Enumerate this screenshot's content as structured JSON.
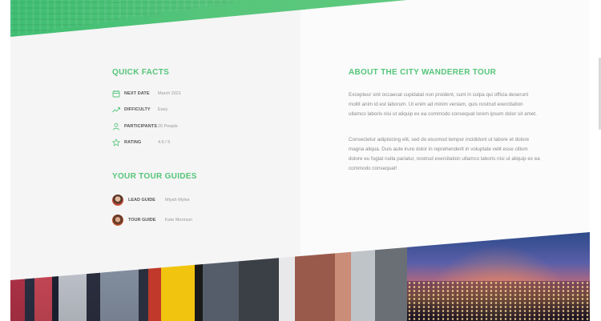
{
  "quick_facts": {
    "title": "Quick Facts",
    "items": [
      {
        "icon": "calendar-icon",
        "label": "Next date",
        "value": "March 2021"
      },
      {
        "icon": "trending-up-icon",
        "label": "Difficulty",
        "value": "Easy"
      },
      {
        "icon": "user-icon",
        "label": "Participants",
        "value": "20 People"
      },
      {
        "icon": "star-icon",
        "label": "Rating",
        "value": "4.6 / 5"
      }
    ]
  },
  "guides": {
    "title": "Your tour guides",
    "items": [
      {
        "role": "Lead guide",
        "name": "Miyah Myles"
      },
      {
        "role": "Tour guide",
        "name": "Kate Morrison"
      }
    ]
  },
  "about": {
    "title": "About the City Wanderer tour",
    "paragraphs": [
      "Excepteur sint occaecat cupidatat non proident, sunt in culpa qui officia deserunt mollit anim id est laborum. Ut enim ad minim veniam, quis nostrud exercitation ullamco laboris nisi ut aliquip ex ea commodo consequat lorem ipsum dolor sit amet.",
      "Consectetur adipisicing elit, sed do eiusmod tempor incididunt ut labore et dolore magna aliqua. Duis aute irure dolor in reprehenderit in voluptate velit esse cillum dolore eu fugiat nulla pariatur, nostrud exercitation ullamco laboris nisi ut aliquip ex ea commodo consequat!"
    ]
  },
  "colors": {
    "accent": "#55c57a",
    "label": "#555555",
    "muted": "#999999"
  }
}
